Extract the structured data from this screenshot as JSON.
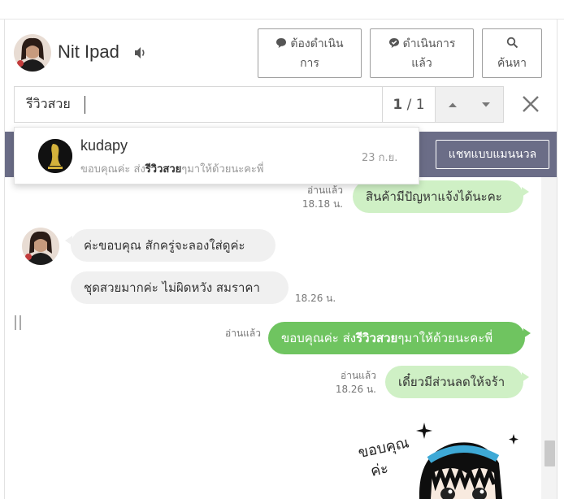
{
  "header": {
    "contact_name": "Nit Ipad",
    "buttons": {
      "todo": [
        "ต้องดำเนิน",
        "การ"
      ],
      "done": [
        "ดำเนินการ",
        "แล้ว"
      ],
      "search": "ค้นหา"
    }
  },
  "search": {
    "query": "รีวิวสวย",
    "result_current": "1",
    "result_total": "/ 1"
  },
  "band": {
    "manual_button": "แชทแบบแมนนวล"
  },
  "dropdown": {
    "name": "kudapy",
    "date": "23 ก.ย.",
    "snippet_before": "ขอบคุณค่ะ ส่ง",
    "snippet_match": "รีวิวสวย",
    "snippet_after": "ๆมาให้ด้วยนะคะพี่"
  },
  "messages": {
    "m1": {
      "text": "สินค้ามีปัญหาแจ้งได้นะคะ",
      "read": "อ่านแล้ว",
      "time": "18.18 น."
    },
    "m2": {
      "text": "ค่ะขอบคุณ  สักครู่จะลองใส่ดูค่ะ"
    },
    "m3": {
      "text": "ชุดสวยมากค่ะ  ไม่ผิดหวัง สมราคา",
      "time": "18.26 น."
    },
    "m4": {
      "before": "ขอบคุณค่ะ ส่ง",
      "match": "รีวิวสวย",
      "after": "ๆมาให้ด้วยนะคะพี่",
      "read": "อ่านแล้ว"
    },
    "m5": {
      "text": "เดี๋ยวมีส่วนลดให้จร้า",
      "read": "อ่านแล้ว",
      "time": "18.26 น."
    }
  },
  "sticker": {
    "text_line1": "ขอบคุณ",
    "text_line2": "ค่ะ"
  },
  "colors": {
    "band": "#6b6d87",
    "outgoing_strong": "#6fc460",
    "outgoing_light": "#cff0c5",
    "incoming": "#f0f0f0"
  }
}
